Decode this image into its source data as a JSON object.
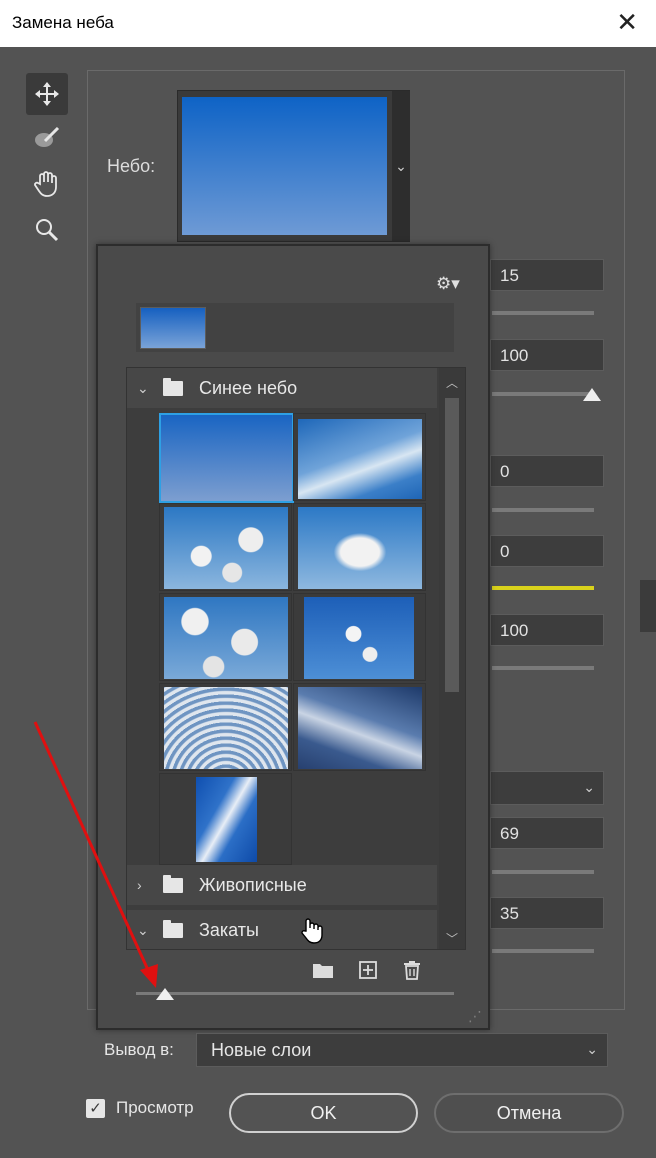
{
  "window": {
    "title": "Замена неба",
    "close_glyph": "✕"
  },
  "tools": [
    {
      "name": "move-tool",
      "icon": "move-icon",
      "active": true
    },
    {
      "name": "brush-tool",
      "icon": "sky-brush-icon",
      "active": false
    },
    {
      "name": "hand-tool",
      "icon": "hand-icon",
      "active": false
    },
    {
      "name": "zoom-tool",
      "icon": "zoom-icon",
      "active": false
    }
  ],
  "sky": {
    "label": "Небо:"
  },
  "fields": {
    "f1": "15",
    "f2": "100",
    "f3": "0",
    "f4": "0",
    "f5": "100",
    "f6": "69",
    "f7": "35"
  },
  "popup": {
    "groups": [
      {
        "name": "Синее небо",
        "expanded": true
      },
      {
        "name": "Живописные",
        "expanded": false
      },
      {
        "name": "Закаты",
        "expanded": true
      }
    ],
    "icons": [
      "gear-icon",
      "new-folder-icon",
      "new-preset-icon",
      "trash-icon"
    ],
    "size_slider": 0.1
  },
  "output": {
    "label": "Вывод в:",
    "value": "Новые слои"
  },
  "preview": {
    "label": "Просмотр",
    "checked": true
  },
  "buttons": {
    "ok": "OK",
    "cancel": "Отмена"
  },
  "colors": {
    "accent_selection": "#2ea0e4",
    "arrow": "#e01010",
    "highlight_track": "#d9d21b"
  }
}
